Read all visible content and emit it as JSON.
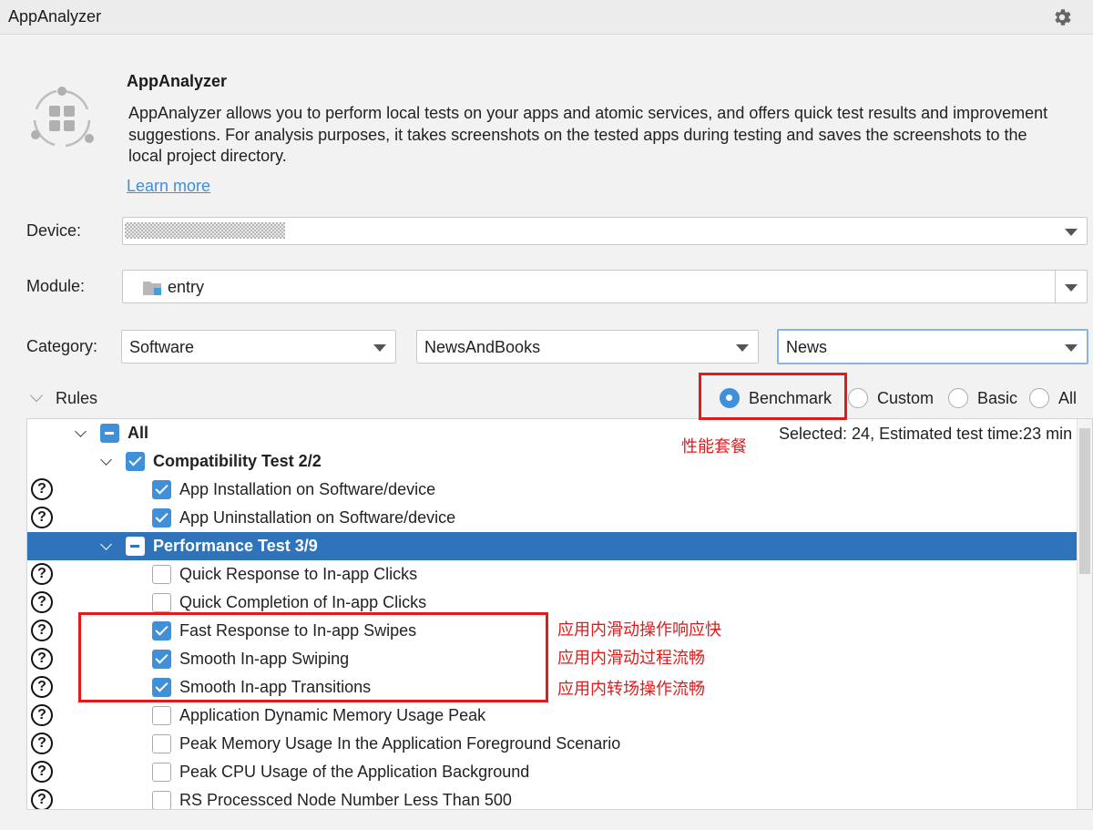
{
  "window": {
    "title": "AppAnalyzer"
  },
  "header": {
    "app_name": "AppAnalyzer",
    "description": "AppAnalyzer allows you to perform local tests on your apps and atomic services, and offers quick test results and improvement suggestions. For analysis  purposes, it takes screenshots on the tested apps during testing and saves the screenshots to the local project directory.",
    "learn_more": "Learn more"
  },
  "form": {
    "device_label": "Device:",
    "module_label": "Module:",
    "module_value": "entry",
    "category_label": "Category:",
    "category_1": "Software",
    "category_2": "NewsAndBooks",
    "category_3": "News"
  },
  "rules": {
    "title": "Rules",
    "modes": [
      "Benchmark",
      "Custom",
      "Basic",
      "All"
    ],
    "selected_mode": "Benchmark",
    "selected_info": "Selected: 24, Estimated test time:23 min",
    "tree": {
      "root": "All",
      "groups": [
        {
          "label": "Compatibility Test 2/2",
          "items": [
            {
              "label": "App Installation on Software/device",
              "checked": true
            },
            {
              "label": "App Uninstallation on Software/device",
              "checked": true
            }
          ]
        },
        {
          "label": "Performance Test 3/9",
          "items": [
            {
              "label": "Quick Response to In-app Clicks",
              "checked": false
            },
            {
              "label": "Quick Completion of In-app Clicks",
              "checked": false
            },
            {
              "label": "Fast Response to In-app Swipes",
              "checked": true
            },
            {
              "label": "Smooth In-app Swiping",
              "checked": true
            },
            {
              "label": "Smooth In-app Transitions",
              "checked": true
            },
            {
              "label": "Application Dynamic Memory Usage Peak",
              "checked": false
            },
            {
              "label": "Peak Memory Usage In the Application Foreground Scenario",
              "checked": false
            },
            {
              "label": "Peak CPU Usage of the Application Background",
              "checked": false
            },
            {
              "label": "RS Processced Node Number Less Than 500",
              "checked": false
            }
          ]
        }
      ]
    }
  },
  "annotations": {
    "benchmark_note": "性能套餐",
    "note_1": "应用内滑动操作响应快",
    "note_2": "应用内滑动过程流畅",
    "note_3": "应用内转场操作流畅"
  },
  "colors": {
    "accent": "#3f8fd9",
    "selection": "#2f73bb",
    "annotation": "#e21a1a"
  },
  "icons": {
    "settings": "gear-icon",
    "logo": "app-grid-logo",
    "help": "question-circle-icon",
    "folder": "module-folder-icon"
  }
}
